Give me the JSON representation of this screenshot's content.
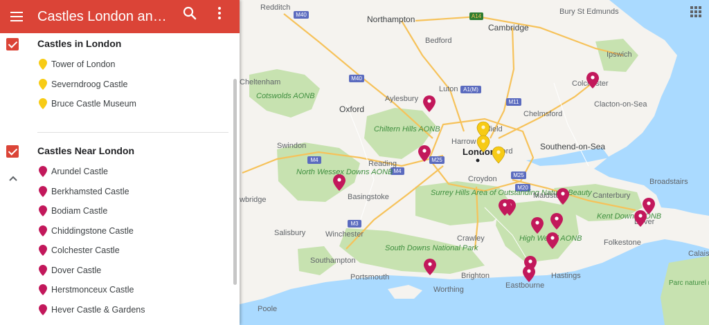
{
  "header": {
    "title": "Castles London and Near London",
    "menu_icon": "hamburger-menu-icon",
    "search_icon": "search-icon",
    "more_icon": "more-vert-icon",
    "color": "#db4437"
  },
  "layers": [
    {
      "title": "Castles in London",
      "checked": true,
      "pin_color": "#f7cb15",
      "items": [
        "Tower of London",
        "Severndroog Castle",
        "Bruce Castle Museum"
      ]
    },
    {
      "title": "Castles Near London",
      "checked": true,
      "pin_color": "#c2185b",
      "items": [
        "Arundel Castle",
        "Berkhamsted Castle",
        "Bodiam Castle",
        "Chiddingstone Castle",
        "Colchester Castle",
        "Dover Castle",
        "Herstmonceux Castle",
        "Hever Castle & Gardens"
      ]
    }
  ],
  "map": {
    "places": [
      "Redditch",
      "Northampton",
      "Bury St Edmunds",
      "Cambridge",
      "Bedford",
      "Ipswich",
      "Cheltenham",
      "Cotswolds AONB",
      "Aylesbury",
      "Luton",
      "Colchester",
      "Clacton-on-Sea",
      "Oxford",
      "Chelmsford",
      "Chiltern Hills AONB",
      "Enfield",
      "Swindon",
      "Harrow",
      "London",
      "Ilford",
      "Southend-on-Sea",
      "Reading",
      "North Wessex Downs AONB",
      "Croydon",
      "Broadstairs",
      "Canterbury",
      "Basingstoke",
      "Surrey Hills Area of Outstanding Natural Beauty",
      "Maidstone",
      "wbridge",
      "Kent Downs AONB",
      "Dover",
      "Salisbury",
      "Winchester",
      "Crawley",
      "High Weald AONB",
      "Folkestone",
      "South Downs National Park",
      "Calais",
      "Southampton",
      "Brighton",
      "Hastings",
      "Portsmouth",
      "Worthing",
      "Eastbourne",
      "Parc naturel régional des caps et marais d'Opale",
      "Poole"
    ],
    "roads": [
      "M40",
      "A14",
      "M40",
      "M11",
      "A1(M)",
      "M4",
      "M25",
      "M4",
      "M25",
      "M20",
      "M3"
    ],
    "apps_icon": "apps-grid-icon",
    "colors": {
      "water": "#aadaff",
      "land": "#f5f3ef",
      "green": "#c7e2b0",
      "motorway": "#f6c25a"
    }
  }
}
